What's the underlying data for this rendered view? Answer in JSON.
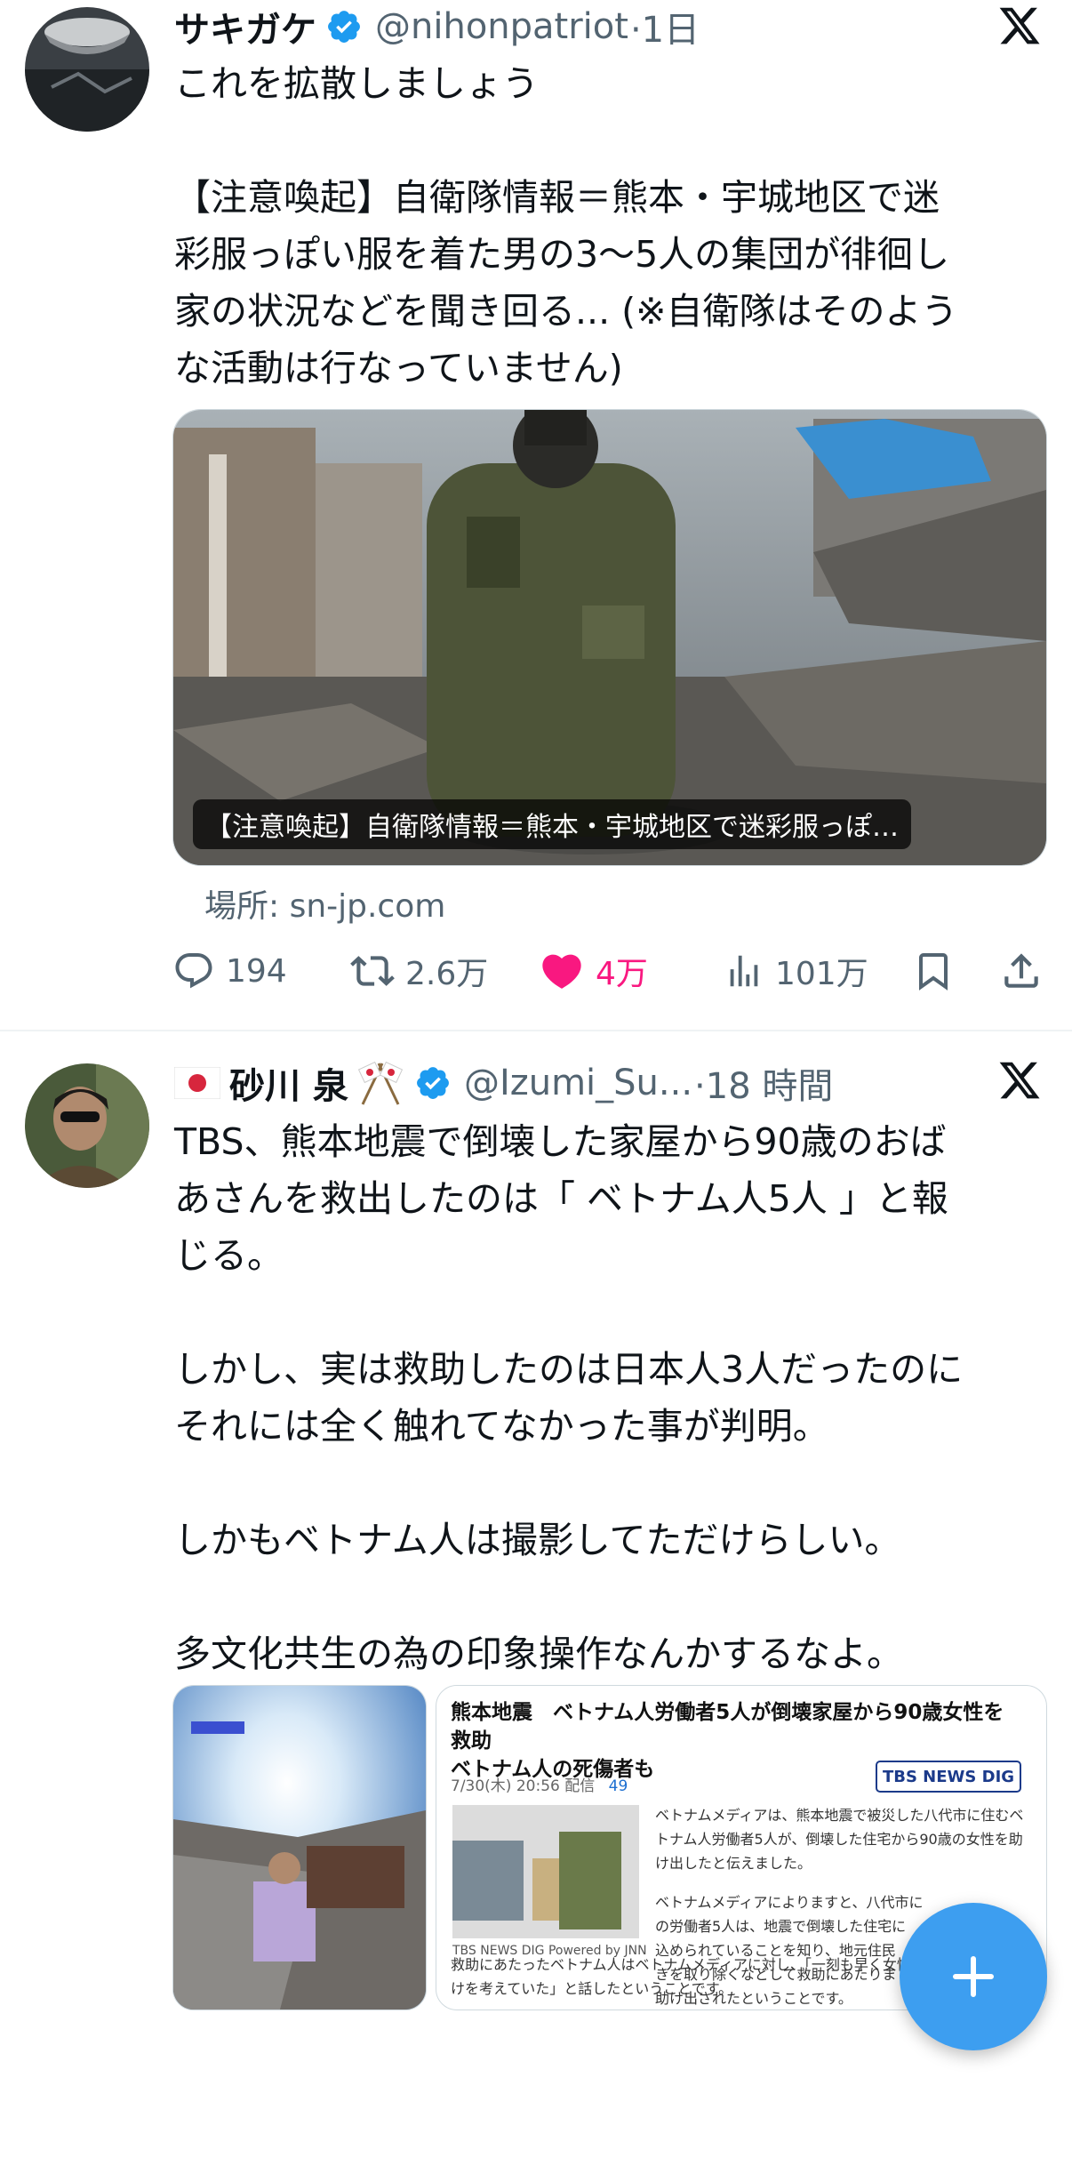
{
  "tweet1": {
    "name": "サキガケ",
    "handle": "@nihonpatriot",
    "time": "·1日",
    "text": "これを拡散しましょう\n\n【注意喚起】自衛隊情報＝熊本・宇城地区で迷\n彩服っぽい服を着た男の3〜5人の集団が徘徊し\n家の状況などを聞き回る... (※自衛隊はそのよう\nな活動は行なっていません)",
    "card_caption": "【注意喚起】自衛隊情報＝熊本・宇城地区で迷彩服っぽ…",
    "source": "場所: sn-jp.com",
    "replies": "194",
    "reposts": "2.6万",
    "likes": "4万",
    "views": "101万"
  },
  "tweet2": {
    "name": "砂川 泉",
    "handle": "@Izumi_Su...",
    "time": "·18 時間",
    "text": "TBS、熊本地震で倒壊した家屋から90歳のおば\nあさんを救出したのは「 ベトナム人5人 」と報\nじる。\n\nしかし、実は救助したのは日本人3人だったのに\nそれには全く触れてなかった事が判明。\n\nしかもベトナム人は撮影してただけらしい。\n\n多文化共生の為の印象操作なんかするなよ。",
    "news": {
      "title": "熊本地震　ベトナム人労働者5人が倒壊家屋から90歳女性を救助\nベトナム人の死傷者も",
      "meta": "7/30(木) 20:56 配信",
      "comments": "49",
      "brand": "TBS NEWS DIG",
      "photo_credit": "TBS NEWS DIG Powered by JNN",
      "para1": "ベトナムメディアは、熊本地震で被災した八代市に住むベ\nトナム人労働者5人が、倒壊した住宅から90歳の女性を助\nけ出したと伝えました。",
      "para2": "ベトナムメディアによりますと、八代市に\nの労働者5人は、地震で倒壊した住宅に\n込められていることを知り、地元住民\nきを取り除くなどして救助にあたりま\n助け出されたということです。",
      "para3": "救助にあたったベトナム人はベトナムメディアに対し、「一刻も早く女性を助けることだ\nけを考えていた」と話したということです。"
    }
  },
  "colors": {
    "like": "#f91880",
    "verified": "#1d9bf0",
    "fab": "#3d9ef0",
    "secondary_text": "#536471"
  },
  "icons": [
    "verified-badge-icon",
    "x-logo-icon",
    "reply-icon",
    "repost-icon",
    "like-icon",
    "views-icon",
    "bookmark-icon",
    "share-icon",
    "plus-icon",
    "flag-japan-icon"
  ]
}
